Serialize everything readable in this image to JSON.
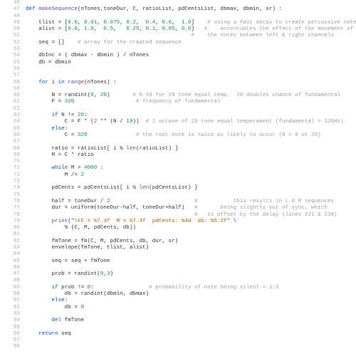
{
  "lines": [
    {
      "n": 46,
      "frags": []
    },
    {
      "n": 47,
      "frags": [
        [
          "kw",
          "def "
        ],
        [
          "fn",
          "makeSequence"
        ],
        [
          "",
          "(nTones,toneDur, C, ratioList, pdCentsList, dbmax, dbmin, sr) :"
        ]
      ]
    },
    {
      "n": 48,
      "frags": []
    },
    {
      "n": 49,
      "frags": [
        [
          "",
          "    tlist = ["
        ],
        [
          "num",
          "0.0"
        ],
        [
          "",
          ", "
        ],
        [
          "num",
          "0.01"
        ],
        [
          "",
          ", "
        ],
        [
          "num",
          "0.075"
        ],
        [
          "",
          ", "
        ],
        [
          "num",
          "0.2"
        ],
        [
          "",
          ",  "
        ],
        [
          "num",
          "0.4"
        ],
        [
          "",
          ", "
        ],
        [
          "num",
          "0.6"
        ],
        [
          "",
          ",  "
        ],
        [
          "num",
          "1.0"
        ],
        [
          "",
          "]    "
        ],
        [
          "com",
          "# using a fast decay to create percussive notes"
        ]
      ]
    },
    {
      "n": 50,
      "frags": [
        [
          "",
          "    alist = ["
        ],
        [
          "num",
          "0.0"
        ],
        [
          "",
          ", "
        ],
        [
          "num",
          "1.0"
        ],
        [
          "",
          ",  "
        ],
        [
          "num",
          "0.5"
        ],
        [
          "",
          ",   "
        ],
        [
          "num",
          "0.25"
        ],
        [
          "",
          ", "
        ],
        [
          "num",
          "0.1"
        ],
        [
          "",
          ", "
        ],
        [
          "num",
          "0.05"
        ],
        [
          "",
          ", "
        ],
        [
          "num",
          "0.0"
        ],
        [
          "",
          "]   "
        ],
        [
          "com",
          "#    accentuates the effect of the movement of"
        ]
      ]
    },
    {
      "n": 51,
      "frags": [
        [
          "",
          "                                                   "
        ],
        [
          "com",
          "#    the notes between left & right channels"
        ]
      ]
    },
    {
      "n": 52,
      "frags": [
        [
          "",
          "    seq = []    "
        ],
        [
          "com",
          "# array for the created sequence"
        ]
      ]
    },
    {
      "n": 53,
      "frags": []
    },
    {
      "n": 54,
      "frags": [
        [
          "",
          "    dbInc = ( dbmax - dbmin ) / nTones"
        ]
      ]
    },
    {
      "n": 55,
      "frags": [
        [
          "",
          "    db = dbmin"
        ]
      ]
    },
    {
      "n": 56,
      "frags": []
    },
    {
      "n": 57,
      "frags": []
    },
    {
      "n": 58,
      "frags": [
        [
          "",
          "    "
        ],
        [
          "kw",
          "for"
        ],
        [
          "",
          " i "
        ],
        [
          "kw",
          "in"
        ],
        [
          "",
          " "
        ],
        [
          "fn",
          "range"
        ],
        [
          "",
          "(nTones) :"
        ]
      ]
    },
    {
      "n": 59,
      "frags": []
    },
    {
      "n": 60,
      "frags": [
        [
          "",
          "        N = randint("
        ],
        [
          "num",
          "0"
        ],
        [
          "",
          ", "
        ],
        [
          "num",
          "20"
        ],
        [
          "",
          ")       "
        ],
        [
          "com",
          "# 0-19 for 19 tone equal temp.  20 doubles chance of fundamental"
        ]
      ]
    },
    {
      "n": 61,
      "frags": [
        [
          "",
          "        F = "
        ],
        [
          "num",
          "320"
        ],
        [
          "",
          "                   "
        ],
        [
          "com",
          "# frequency of fundamental"
        ]
      ]
    },
    {
      "n": 62,
      "frags": []
    },
    {
      "n": 63,
      "frags": [
        [
          "",
          "        "
        ],
        [
          "kw",
          "if"
        ],
        [
          "",
          " N != "
        ],
        [
          "num",
          "20"
        ],
        [
          "",
          ":"
        ]
      ]
    },
    {
      "n": 64,
      "frags": [
        [
          "",
          "            C = F * ("
        ],
        [
          "num",
          "2"
        ],
        [
          "",
          " ** (N / "
        ],
        [
          "num",
          "19"
        ],
        [
          "",
          "))  "
        ],
        [
          "com",
          "# 1 octave of 19 tone equal temperament (fundamental = 320Hz)"
        ]
      ]
    },
    {
      "n": 65,
      "frags": [
        [
          "",
          "        "
        ],
        [
          "kw",
          "else"
        ],
        [
          "",
          ":"
        ]
      ]
    },
    {
      "n": 66,
      "frags": [
        [
          "",
          "            C = "
        ],
        [
          "num",
          "320"
        ],
        [
          "",
          "               "
        ],
        [
          "com",
          "# the root note is twice as likely to occur (N = 0 or 20)"
        ]
      ]
    },
    {
      "n": 67,
      "frags": []
    },
    {
      "n": 68,
      "frags": [
        [
          "",
          "        ratio = ratioList[ i % "
        ],
        [
          "fn",
          "len"
        ],
        [
          "",
          "(ratioList) ]"
        ]
      ]
    },
    {
      "n": 69,
      "frags": [
        [
          "",
          "        M = C * ratio"
        ]
      ]
    },
    {
      "n": 70,
      "frags": []
    },
    {
      "n": 71,
      "frags": [
        [
          "",
          "        "
        ],
        [
          "kw",
          "while"
        ],
        [
          "",
          " M > "
        ],
        [
          "num",
          "4000"
        ],
        [
          "",
          " :"
        ]
      ]
    },
    {
      "n": 72,
      "frags": [
        [
          "",
          "            M /= "
        ],
        [
          "num",
          "2"
        ]
      ]
    },
    {
      "n": 73,
      "frags": []
    },
    {
      "n": 74,
      "frags": [
        [
          "",
          "        pdCents = pdCentsList[ i % "
        ],
        [
          "fn",
          "len"
        ],
        [
          "",
          "(pdCentsList) ]"
        ]
      ]
    },
    {
      "n": 75,
      "frags": []
    },
    {
      "n": 76,
      "frags": [
        [
          "",
          "        half = toneDur / "
        ],
        [
          "num",
          "2"
        ],
        [
          "",
          "                          "
        ],
        [
          "com",
          "#           this results in L & R sequences"
        ]
      ]
    },
    {
      "n": 77,
      "frags": [
        [
          "",
          "        dur = uniform(toneDur-half, toneDur+half)   "
        ],
        [
          "com",
          "#       being slightly out of sync, which"
        ]
      ]
    },
    {
      "n": 78,
      "frags": [
        [
          "",
          "                                                    "
        ],
        [
          "com",
          "#   is offset by the delay (lines 221 & 238)"
        ]
      ]
    },
    {
      "n": 79,
      "frags": [
        [
          "",
          "        "
        ],
        [
          "fn",
          "print"
        ],
        [
          "",
          "("
        ],
        [
          "str",
          "\"\\tC = %7.3f  M = %7.3f  pdCents: %4d  db: %5.2f\""
        ],
        [
          "",
          " \\"
        ]
      ]
    },
    {
      "n": 80,
      "frags": [
        [
          "",
          "            % (C, M, pdCents, db))"
        ]
      ]
    },
    {
      "n": 81,
      "frags": []
    },
    {
      "n": 82,
      "frags": [
        [
          "",
          "        fmTone = fm(C, M, pdCents, db, dur, sr)"
        ]
      ]
    },
    {
      "n": 83,
      "frags": [
        [
          "",
          "        envelope(fmTone, tlist, alist)"
        ]
      ]
    },
    {
      "n": 84,
      "frags": []
    },
    {
      "n": 85,
      "frags": [
        [
          "",
          "        seq = seq + fmTone"
        ]
      ]
    },
    {
      "n": 86,
      "frags": []
    },
    {
      "n": 87,
      "frags": [
        [
          "",
          "        prob = randint("
        ],
        [
          "num",
          "0"
        ],
        [
          "",
          ","
        ],
        [
          "num",
          "3"
        ],
        [
          "",
          ")"
        ]
      ]
    },
    {
      "n": 88,
      "frags": []
    },
    {
      "n": 89,
      "frags": [
        [
          "",
          "        "
        ],
        [
          "kw",
          "if"
        ],
        [
          "",
          " prob != "
        ],
        [
          "num",
          "0"
        ],
        [
          "",
          ":                 "
        ],
        [
          "com",
          "# probability of note being silent = 1:3"
        ]
      ]
    },
    {
      "n": 90,
      "frags": [
        [
          "",
          "            db = randint(dbmin, dbmax)"
        ]
      ]
    },
    {
      "n": 91,
      "frags": [
        [
          "",
          "        "
        ],
        [
          "kw",
          "else"
        ],
        [
          "",
          ":"
        ]
      ]
    },
    {
      "n": 92,
      "frags": [
        [
          "",
          "            db = "
        ],
        [
          "num",
          "0"
        ]
      ]
    },
    {
      "n": 93,
      "frags": []
    },
    {
      "n": 94,
      "frags": [
        [
          "",
          "        "
        ],
        [
          "kw",
          "del"
        ],
        [
          "",
          " fmTone"
        ]
      ]
    },
    {
      "n": 95,
      "frags": []
    },
    {
      "n": 96,
      "frags": [
        [
          "",
          "    "
        ],
        [
          "kw",
          "return"
        ],
        [
          "",
          " seq"
        ]
      ]
    },
    {
      "n": 97,
      "frags": []
    },
    {
      "n": 98,
      "frags": []
    }
  ]
}
